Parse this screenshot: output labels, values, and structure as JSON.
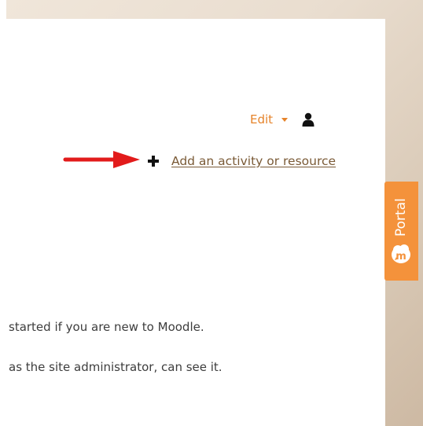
{
  "header": {
    "edit_label": "Edit"
  },
  "course_actions": {
    "add_activity_label": "Add an activity or resource"
  },
  "portal_tab": {
    "label": "Portal"
  },
  "content": {
    "line1": "started if you are new to Moodle.",
    "line2": "as the site administrator, can see it."
  },
  "icons": {
    "user": "user-icon",
    "plus": "plus-icon",
    "arrow": "red-arrow-icon",
    "portal_logo": "moodle-cloud-logo-icon",
    "edit_caret": "caret-down-icon"
  },
  "colors": {
    "accent_orange": "#e6832a",
    "portal_orange": "#f4923b",
    "link_brown": "#7a5a36",
    "arrow_red": "#e21b1b",
    "text": "#3d3d3d"
  }
}
